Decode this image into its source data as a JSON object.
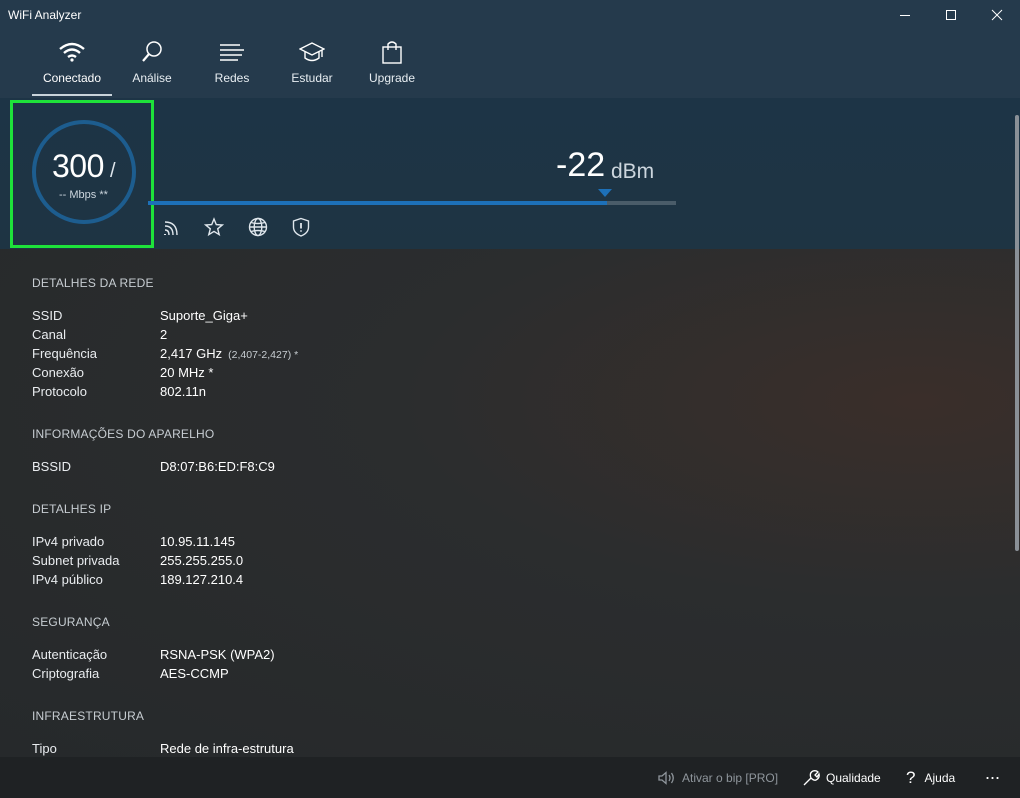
{
  "window": {
    "title": "WiFi Analyzer"
  },
  "nav": {
    "items": [
      {
        "label": "Conectado",
        "icon": "wifi-icon"
      },
      {
        "label": "Análise",
        "icon": "magnifier-icon"
      },
      {
        "label": "Redes",
        "icon": "list-icon"
      },
      {
        "label": "Estudar",
        "icon": "graduation-cap-icon"
      },
      {
        "label": "Upgrade",
        "icon": "shopping-bag-icon"
      }
    ],
    "active": "Conectado"
  },
  "hero": {
    "speed": "300",
    "speed_slash": "/",
    "speed_unit": "-- Mbps **",
    "signal_value": "-22",
    "signal_unit": "dBm",
    "signal_level": 0.87,
    "icons": [
      "wifi-signal-icon",
      "star-icon",
      "globe-icon",
      "shield-icon"
    ]
  },
  "sections": {
    "rede": {
      "title": "DETALHES DA REDE",
      "rows": [
        {
          "label": "SSID",
          "value": "Suporte_Giga+"
        },
        {
          "label": "Canal",
          "value": "2"
        },
        {
          "label": "Frequência",
          "value": "2,417 GHz",
          "extra": "(2,407-2,427) *"
        },
        {
          "label": "Conexão",
          "value": "20 MHz *"
        },
        {
          "label": "Protocolo",
          "value": "802.11n"
        }
      ]
    },
    "aparelho": {
      "title": "INFORMAÇÕES DO APARELHO",
      "rows": [
        {
          "label": "BSSID",
          "value": "D8:07:B6:ED:F8:C9"
        }
      ]
    },
    "ip": {
      "title": "DETALHES IP",
      "rows": [
        {
          "label": "IPv4 privado",
          "value": "10.95.11.145"
        },
        {
          "label": "Subnet privada",
          "value": "255.255.255.0"
        },
        {
          "label": "IPv4 público",
          "value": "189.127.210.4"
        }
      ]
    },
    "seguranca": {
      "title": "SEGURANÇA",
      "rows": [
        {
          "label": "Autenticação",
          "value": "RSNA-PSK (WPA2)"
        },
        {
          "label": "Criptografia",
          "value": "AES-CCMP"
        }
      ]
    },
    "infra": {
      "title": "INFRAESTRUTURA",
      "rows": [
        {
          "label": "Tipo",
          "value": "Rede de infra-estrutura"
        }
      ]
    }
  },
  "bottombar": {
    "beep": "Ativar o bip [PRO]",
    "quality": "Qualidade",
    "help": "Ajuda",
    "more": "..."
  },
  "colors": {
    "header": "#253a4c",
    "accent": "#1d70b8",
    "highlight": "#1ee23a"
  }
}
